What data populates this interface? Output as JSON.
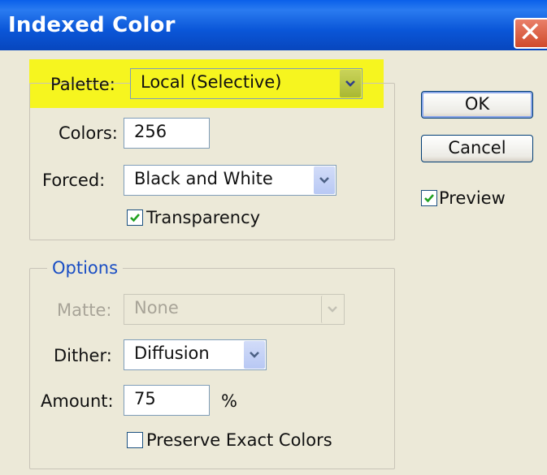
{
  "window": {
    "title": "Indexed Color"
  },
  "palette": {
    "label": "Palette:",
    "value": "Local (Selective)"
  },
  "colors": {
    "label": "Colors:",
    "value": "256"
  },
  "forced": {
    "label": "Forced:",
    "value": "Black and White"
  },
  "transparency": {
    "label": "Transparency",
    "checked": true
  },
  "options": {
    "title": "Options",
    "matte": {
      "label": "Matte:",
      "value": "None",
      "enabled": false
    },
    "dither": {
      "label": "Dither:",
      "value": "Diffusion"
    },
    "amount": {
      "label": "Amount:",
      "value": "75",
      "unit": "%"
    },
    "preserve": {
      "label": "Preserve Exact Colors",
      "checked": false
    }
  },
  "buttons": {
    "ok": "OK",
    "cancel": "Cancel"
  },
  "preview": {
    "label": "Preview",
    "checked": true
  },
  "colors_theme": {
    "highlight": "#f6f51f",
    "title_bar": "#0a56d8",
    "close_button": "#d04a2b",
    "group_title": "#1a4ec4"
  }
}
